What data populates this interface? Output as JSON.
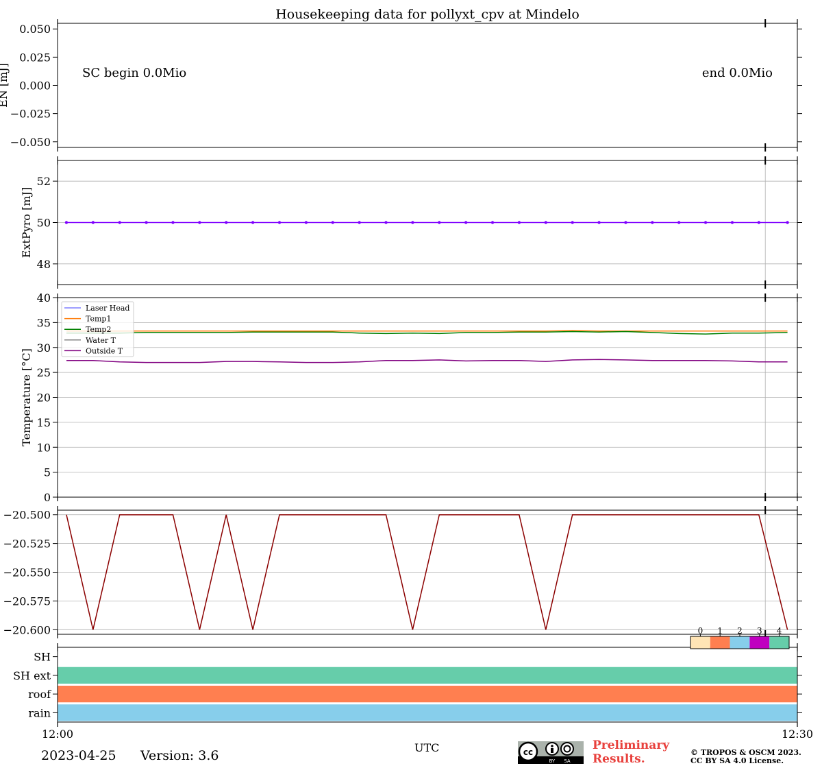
{
  "chart_data": [
    {
      "type": "line",
      "id": "energy",
      "ylabel": "EN [mJ]",
      "ylim": [
        -0.055,
        0.055
      ],
      "yticks": [
        -0.05,
        -0.025,
        0.0,
        0.025,
        0.05
      ],
      "ytick_labels": [
        "−0.050",
        "−0.025",
        "0.000",
        "0.025",
        "0.050"
      ],
      "annotations": [
        "SC begin 0.0Mio",
        "end 0.0Mio"
      ],
      "grid": false,
      "series": []
    },
    {
      "type": "line",
      "id": "extpyro",
      "ylabel": "ExtPyro [mJ]",
      "ylim": [
        47,
        53
      ],
      "yticks": [
        48,
        50,
        52
      ],
      "ytick_labels": [
        "48",
        "50",
        "52"
      ],
      "grid": true,
      "color": "#7f00ff",
      "values": [
        50,
        50,
        50,
        50,
        50,
        50,
        50,
        50,
        50,
        50,
        50,
        50,
        50,
        50,
        50,
        50,
        50,
        50,
        50,
        50,
        50,
        50,
        50,
        50,
        50,
        50,
        50,
        50
      ]
    },
    {
      "type": "line",
      "id": "temperature",
      "ylabel": "Temperature [$^\\circ C$]",
      "ylim": [
        0,
        40
      ],
      "yticks": [
        0,
        5,
        10,
        15,
        20,
        25,
        30,
        35,
        40
      ],
      "ytick_labels": [
        "0",
        "5",
        "10",
        "15",
        "20",
        "25",
        "30",
        "35",
        "40"
      ],
      "grid": true,
      "legend_position": "top-left",
      "series": [
        {
          "name": "Laser Head",
          "color": "#7f7fff",
          "values": []
        },
        {
          "name": "Temp1",
          "color": "#ff7f0e",
          "values": [
            33.3,
            33.3,
            33.3,
            33.3,
            33.3,
            33.3,
            33.3,
            33.3,
            33.3,
            33.3,
            33.3,
            33.3,
            33.3,
            33.3,
            33.3,
            33.3,
            33.3,
            33.3,
            33.3,
            33.4,
            33.3,
            33.3,
            33.3,
            33.3,
            33.3,
            33.3,
            33.3,
            33.3
          ]
        },
        {
          "name": "Temp2",
          "color": "#008000",
          "values": [
            32.9,
            32.9,
            32.9,
            33.0,
            33.0,
            33.0,
            33.0,
            33.1,
            33.1,
            33.1,
            33.1,
            32.9,
            32.8,
            32.9,
            32.8,
            33.0,
            33.0,
            33.1,
            33.1,
            33.2,
            33.1,
            33.2,
            33.0,
            32.8,
            32.7,
            32.9,
            32.9,
            33.0
          ]
        },
        {
          "name": "Water T",
          "color": "#808080",
          "values": []
        },
        {
          "name": "Outside T",
          "color": "#800080",
          "values": [
            27.4,
            27.4,
            27.1,
            27.0,
            27.0,
            27.0,
            27.2,
            27.2,
            27.1,
            27.0,
            27.0,
            27.1,
            27.4,
            27.4,
            27.5,
            27.3,
            27.4,
            27.4,
            27.2,
            27.5,
            27.6,
            27.5,
            27.4,
            27.4,
            27.4,
            27.3,
            27.1,
            27.1
          ]
        }
      ]
    },
    {
      "type": "line",
      "id": "fourth",
      "ylabel": "",
      "ylim": [
        -20.604,
        -20.496
      ],
      "yticks": [
        -20.6,
        -20.575,
        -20.55,
        -20.525,
        -20.5
      ],
      "ytick_labels": [
        "−20.600",
        "−20.575",
        "−20.550",
        "−20.525",
        "−20.500"
      ],
      "grid": true,
      "color": "#8b0000",
      "values": [
        -20.5,
        -20.6,
        -20.5,
        -20.5,
        -20.5,
        -20.6,
        -20.5,
        -20.6,
        -20.5,
        -20.5,
        -20.5,
        -20.5,
        -20.5,
        -20.6,
        -20.5,
        -20.5,
        -20.5,
        -20.5,
        -20.6,
        -20.5,
        -20.5,
        -20.5,
        -20.5,
        -20.5,
        -20.5,
        -20.5,
        -20.5,
        -20.6
      ]
    },
    {
      "type": "heatmap",
      "id": "status",
      "rows": [
        "SH",
        "SH ext",
        "roof",
        "rain"
      ],
      "row_states": [
        null,
        4,
        1,
        2
      ],
      "colorbar": {
        "ticks": [
          "0",
          "1",
          "2",
          "3",
          "4"
        ],
        "colors": [
          "#ffe4b5",
          "#ff7f50",
          "#87ceeb",
          "#c000c0",
          "#66cdaa"
        ]
      }
    }
  ],
  "x_axis": {
    "label": "UTC",
    "tick_labels": [
      "12:00",
      "12:30"
    ],
    "range_minutes": [
      0,
      30
    ],
    "sample_times_minutes": [
      0.36,
      1.44,
      2.52,
      3.6,
      4.68,
      5.76,
      6.84,
      7.92,
      9.0,
      10.08,
      11.16,
      12.24,
      13.32,
      14.4,
      15.48,
      16.56,
      17.64,
      18.72,
      19.8,
      20.88,
      21.96,
      23.04,
      24.12,
      25.2,
      26.28,
      27.36,
      28.44,
      29.6
    ]
  },
  "header": {
    "title": "Housekeeping data for pollyxt_cpv at Mindelo"
  },
  "footer": {
    "date": "2023-04-25",
    "version": "Version: 3.6",
    "preliminary_line1": "Preliminary",
    "preliminary_line2": "Results.",
    "copyright_line1": "© TROPOS & OSCM 2023.",
    "copyright_line2": "CC BY SA 4.0 License.",
    "license_logo": "cc-by-sa-logo",
    "license_badges": [
      "BY",
      "SA"
    ]
  }
}
